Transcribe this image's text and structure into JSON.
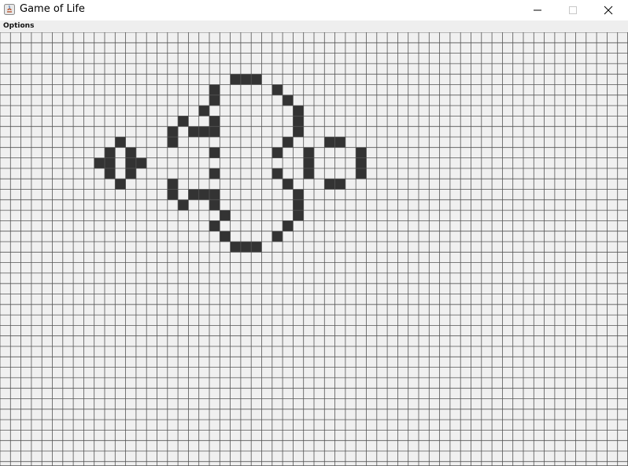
{
  "window": {
    "title": "Game of Life",
    "app_icon": "java-icon",
    "controls": [
      "minimize-icon",
      "maximize-icon",
      "close-icon"
    ]
  },
  "menubar": {
    "items": [
      {
        "label": "Options"
      }
    ]
  },
  "grid": {
    "columns": 60,
    "rows": 42,
    "colors": {
      "background": "#f0f0f0",
      "grid_line": "#555555",
      "live_cell": "#333333"
    },
    "live_cells": [
      [
        22,
        4
      ],
      [
        23,
        4
      ],
      [
        24,
        4
      ],
      [
        20,
        5
      ],
      [
        26,
        5
      ],
      [
        20,
        6
      ],
      [
        27,
        6
      ],
      [
        19,
        7
      ],
      [
        28,
        7
      ],
      [
        17,
        8
      ],
      [
        20,
        8
      ],
      [
        28,
        8
      ],
      [
        16,
        9
      ],
      [
        18,
        9
      ],
      [
        19,
        9
      ],
      [
        20,
        9
      ],
      [
        28,
        9
      ],
      [
        11,
        10
      ],
      [
        16,
        10
      ],
      [
        27,
        10
      ],
      [
        31,
        10
      ],
      [
        32,
        10
      ],
      [
        10,
        11
      ],
      [
        12,
        11
      ],
      [
        20,
        11
      ],
      [
        26,
        11
      ],
      [
        29,
        11
      ],
      [
        34,
        11
      ],
      [
        9,
        12
      ],
      [
        10,
        12
      ],
      [
        12,
        12
      ],
      [
        13,
        12
      ],
      [
        29,
        12
      ],
      [
        34,
        12
      ],
      [
        10,
        13
      ],
      [
        12,
        13
      ],
      [
        20,
        13
      ],
      [
        26,
        13
      ],
      [
        29,
        13
      ],
      [
        34,
        13
      ],
      [
        11,
        14
      ],
      [
        16,
        14
      ],
      [
        27,
        14
      ],
      [
        31,
        14
      ],
      [
        32,
        14
      ],
      [
        16,
        15
      ],
      [
        18,
        15
      ],
      [
        19,
        15
      ],
      [
        20,
        15
      ],
      [
        28,
        15
      ],
      [
        17,
        16
      ],
      [
        20,
        16
      ],
      [
        28,
        16
      ],
      [
        21,
        17
      ],
      [
        28,
        17
      ],
      [
        20,
        18
      ],
      [
        27,
        18
      ],
      [
        21,
        19
      ],
      [
        26,
        19
      ],
      [
        22,
        20
      ],
      [
        23,
        20
      ],
      [
        24,
        20
      ]
    ]
  }
}
